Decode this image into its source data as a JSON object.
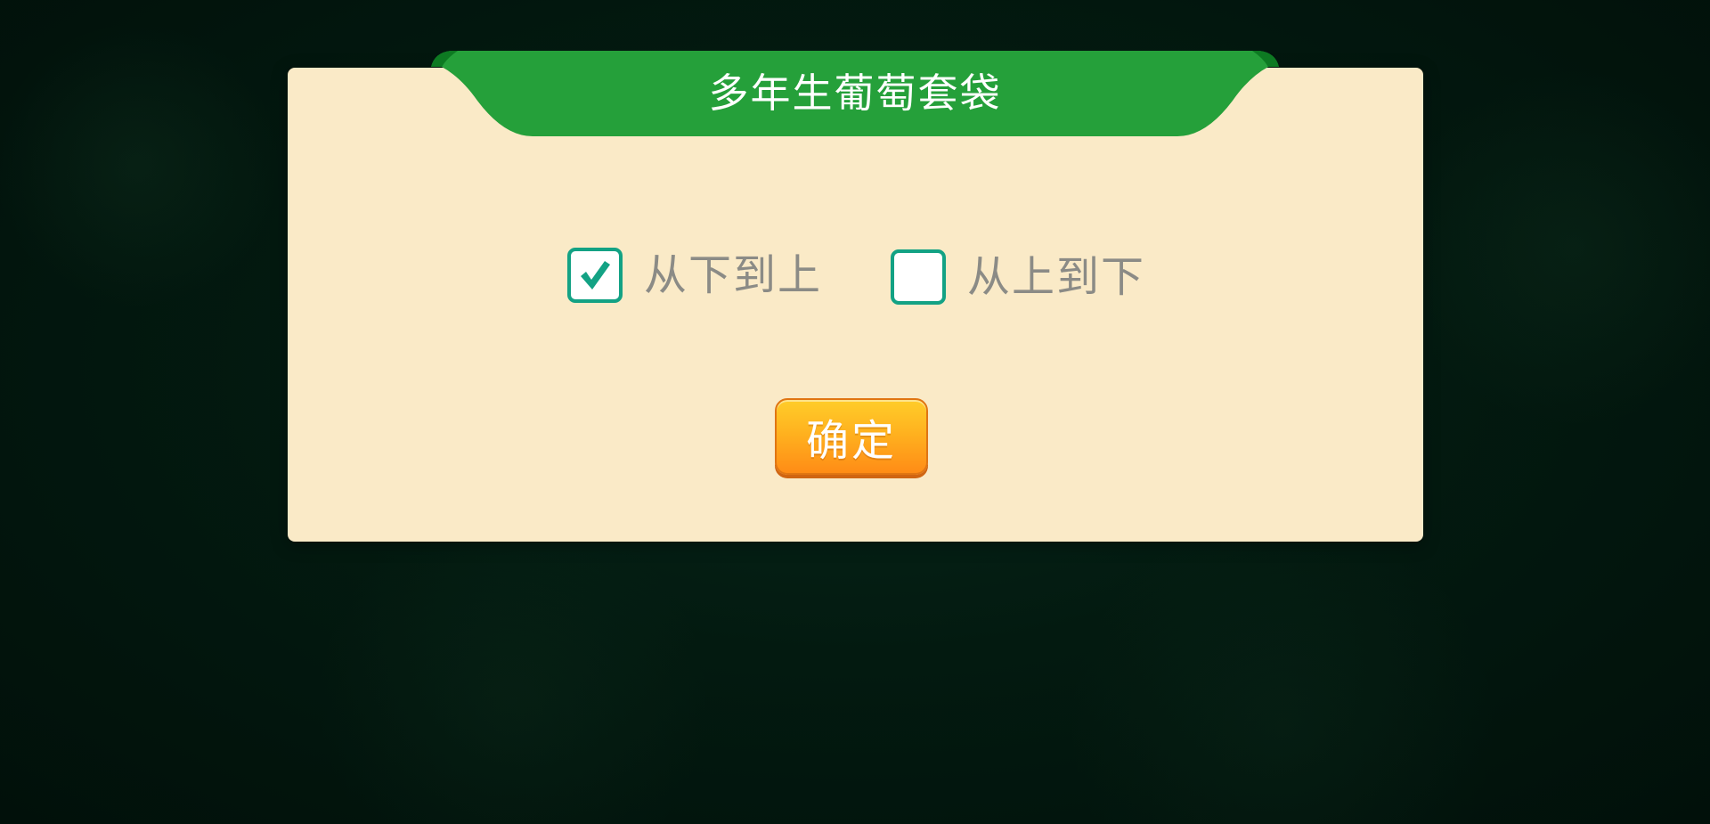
{
  "dialog": {
    "title": "多年生葡萄套袋",
    "options": [
      {
        "label": "从下到上",
        "checked": true
      },
      {
        "label": "从上到下",
        "checked": false
      }
    ],
    "confirm_label": "确定"
  },
  "colors": {
    "background": "#031a10",
    "panel": "#faeac7",
    "ribbon": "#25a03a",
    "checkbox_border": "#13a284",
    "check_mark": "#13a284",
    "button": "#ffb21f"
  },
  "icons": {
    "check": "check-icon"
  }
}
